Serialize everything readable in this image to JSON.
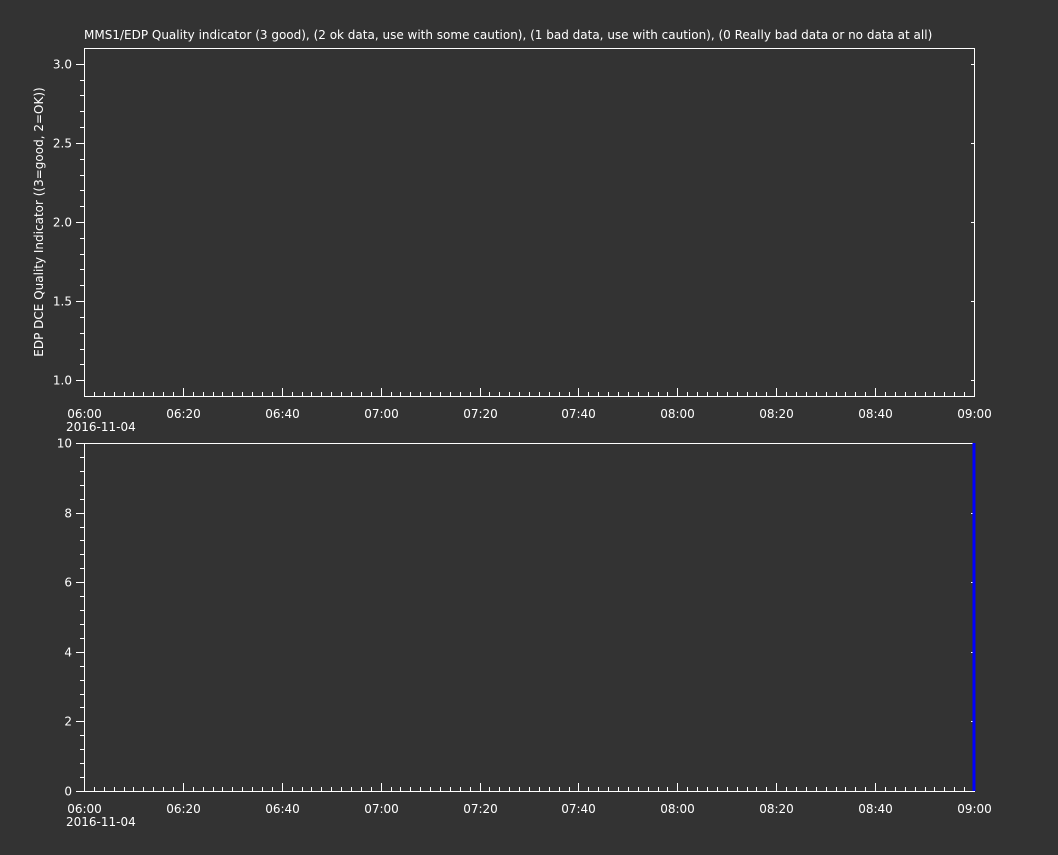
{
  "colors": {
    "background": "#333333",
    "foreground": "#ffffff",
    "trace": "#0000ff"
  },
  "chart_data": [
    {
      "type": "line",
      "title": "MMS1/EDP  Quality indicator (3 good), (2 ok data, use with some caution), (1 bad data, use with caution), (0 Really bad data or no data at all)",
      "xlabel": "",
      "ylabel": "EDP DCE Quality Indicator ((3=good, 2=OK))",
      "x_range": [
        "2016-11-04 06:00",
        "2016-11-04 09:00"
      ],
      "x_ticks": [
        "06:00",
        "06:20",
        "06:40",
        "07:00",
        "07:20",
        "07:40",
        "08:00",
        "08:20",
        "08:40",
        "09:00"
      ],
      "x_date_label": "2016-11-04",
      "ylim": [
        0.9,
        3.1
      ],
      "y_ticks": [
        1.0,
        1.5,
        2.0,
        2.5,
        3.0
      ],
      "y_tick_labels": [
        "1.0",
        "1.5",
        "2.0",
        "2.5",
        "3.0"
      ],
      "grid": false,
      "series": []
    },
    {
      "type": "line",
      "title": "",
      "xlabel": "",
      "ylabel": "",
      "x_range": [
        "2016-11-04 06:00",
        "2016-11-04 09:00"
      ],
      "x_ticks": [
        "06:00",
        "06:20",
        "06:40",
        "07:00",
        "07:20",
        "07:40",
        "08:00",
        "08:20",
        "08:40",
        "09:00"
      ],
      "x_date_label": "2016-11-04",
      "ylim": [
        0,
        10
      ],
      "y_ticks": [
        0,
        2,
        4,
        6,
        8,
        10
      ],
      "y_tick_labels": [
        "0",
        "2",
        "4",
        "6",
        "8",
        "10"
      ],
      "grid": false,
      "series": [
        {
          "x": [
            "2016-11-04 09:00",
            "2016-11-04 09:00"
          ],
          "y": [
            0,
            10
          ]
        }
      ]
    }
  ]
}
